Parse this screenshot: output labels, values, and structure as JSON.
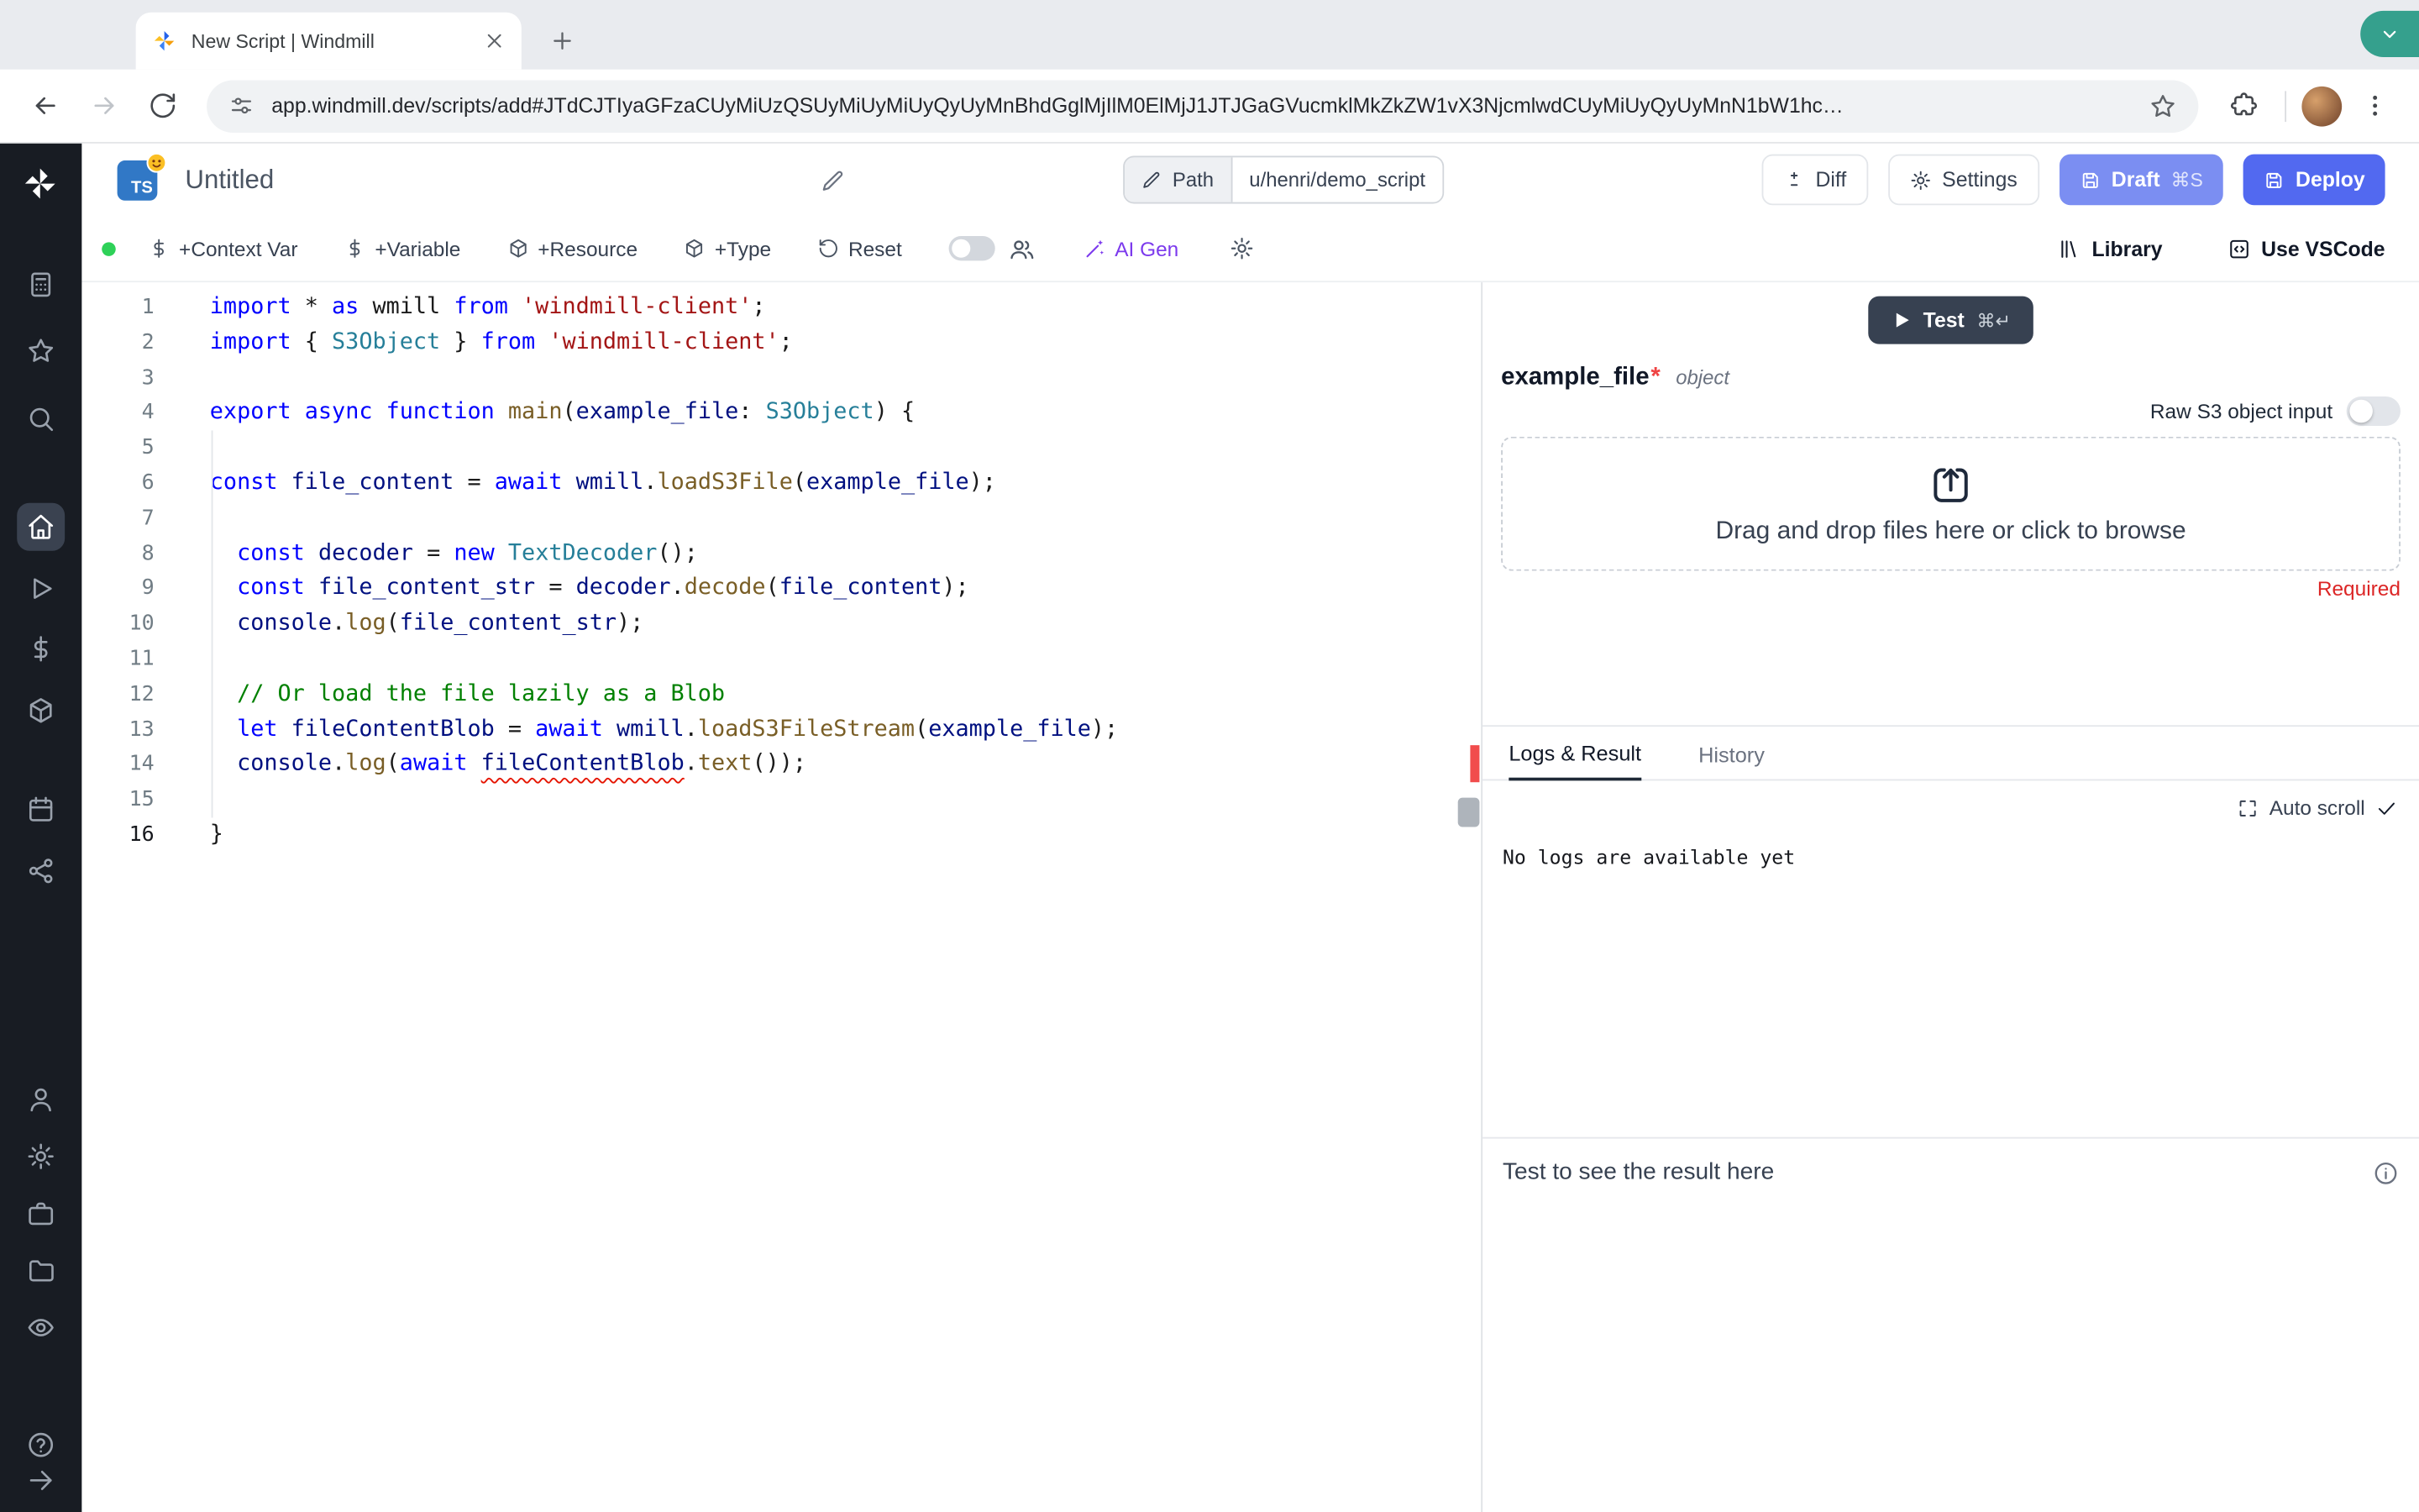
{
  "browser": {
    "tab_title": "New Script | Windmill",
    "url": "app.windmill.dev/scripts/add#JTdCJTIyaGFzaCUyMiUzQSUyMiUyMiUyQyUyMnBhdGglMjIlM0ElMjJ1JTJGaGVucmklMkZkZW1vX3NjcmlwdCUyMiUyQyUyMnN1bW1hc…"
  },
  "header": {
    "lang_badge": "TS",
    "title": "Untitled",
    "path_label": "Path",
    "path_value": "u/henri/demo_script",
    "diff": "Diff",
    "settings": "Settings",
    "draft": "Draft",
    "draft_shortcut": "⌘S",
    "deploy": "Deploy"
  },
  "toolbar": {
    "items": [
      {
        "icon": "dollar",
        "label": "+Context Var",
        "name": "add-context-var"
      },
      {
        "icon": "dollar",
        "label": "+Variable",
        "name": "add-variable"
      },
      {
        "icon": "box",
        "label": "+Resource",
        "name": "add-resource"
      },
      {
        "icon": "box",
        "label": "+Type",
        "name": "add-type"
      },
      {
        "icon": "rotateccw",
        "label": "Reset",
        "name": "reset"
      }
    ],
    "ai_gen": "AI Gen",
    "library": "Library",
    "vscode": "Use VSCode"
  },
  "sidebar": {
    "items": [
      {
        "icon": "calculator",
        "name": "apps"
      },
      {
        "icon": "star",
        "name": "favorites"
      },
      {
        "icon": "search",
        "name": "search"
      },
      {
        "icon": "home",
        "name": "home",
        "active": true
      },
      {
        "icon": "play",
        "name": "runs"
      },
      {
        "icon": "dollar",
        "name": "variables"
      },
      {
        "icon": "box",
        "name": "resources"
      },
      {
        "icon": "calendar",
        "name": "schedules"
      },
      {
        "icon": "nodes",
        "name": "flows"
      },
      {
        "icon": "user",
        "name": "users"
      },
      {
        "icon": "gear",
        "name": "settings"
      },
      {
        "icon": "briefcase",
        "name": "workers"
      },
      {
        "icon": "folder",
        "name": "folders"
      },
      {
        "icon": "eye",
        "name": "audit-logs"
      },
      {
        "icon": "help",
        "name": "help"
      },
      {
        "icon": "arrowright",
        "name": "expand-sidebar"
      }
    ]
  },
  "editor": {
    "active_line": 16,
    "lines": [
      [
        [
          "k",
          "import"
        ],
        [
          "p",
          " * "
        ],
        [
          "k",
          "as"
        ],
        [
          "p",
          " wmill "
        ],
        [
          "k",
          "from"
        ],
        [
          "p",
          " "
        ],
        [
          "s",
          "'windmill-client'"
        ],
        [
          "p",
          ";"
        ]
      ],
      [
        [
          "k",
          "import"
        ],
        [
          "p",
          " { "
        ],
        [
          "t",
          "S3Object"
        ],
        [
          "p",
          " } "
        ],
        [
          "k",
          "from"
        ],
        [
          "p",
          " "
        ],
        [
          "s",
          "'windmill-client'"
        ],
        [
          "p",
          ";"
        ]
      ],
      [],
      [
        [
          "k",
          "export"
        ],
        [
          "p",
          " "
        ],
        [
          "k",
          "async"
        ],
        [
          "p",
          " "
        ],
        [
          "k",
          "function"
        ],
        [
          "p",
          " "
        ],
        [
          "f",
          "main"
        ],
        [
          "p",
          "("
        ],
        [
          "v",
          "example_file"
        ],
        [
          "p",
          ": "
        ],
        [
          "t",
          "S3Object"
        ],
        [
          "p",
          ") {"
        ]
      ],
      [],
      [
        [
          "k",
          "const"
        ],
        [
          "p",
          " "
        ],
        [
          "v",
          "file_content"
        ],
        [
          "p",
          " = "
        ],
        [
          "k",
          "await"
        ],
        [
          "p",
          " "
        ],
        [
          "v",
          "wmill"
        ],
        [
          "p",
          "."
        ],
        [
          "f",
          "loadS3File"
        ],
        [
          "p",
          "("
        ],
        [
          "v",
          "example_file"
        ],
        [
          "p",
          ");"
        ]
      ],
      [],
      [
        [
          "p",
          "  "
        ],
        [
          "k",
          "const"
        ],
        [
          "p",
          " "
        ],
        [
          "v",
          "decoder"
        ],
        [
          "p",
          " = "
        ],
        [
          "k",
          "new"
        ],
        [
          "p",
          " "
        ],
        [
          "t",
          "TextDecoder"
        ],
        [
          "p",
          "();"
        ]
      ],
      [
        [
          "p",
          "  "
        ],
        [
          "k",
          "const"
        ],
        [
          "p",
          " "
        ],
        [
          "v",
          "file_content_str"
        ],
        [
          "p",
          " = "
        ],
        [
          "v",
          "decoder"
        ],
        [
          "p",
          "."
        ],
        [
          "f",
          "decode"
        ],
        [
          "p",
          "("
        ],
        [
          "v",
          "file_content"
        ],
        [
          "p",
          ");"
        ]
      ],
      [
        [
          "p",
          "  "
        ],
        [
          "v",
          "console"
        ],
        [
          "p",
          "."
        ],
        [
          "f",
          "log"
        ],
        [
          "p",
          "("
        ],
        [
          "v",
          "file_content_str"
        ],
        [
          "p",
          ");"
        ]
      ],
      [],
      [
        [
          "p",
          "  "
        ],
        [
          "c",
          "// Or load the file lazily as a Blob"
        ]
      ],
      [
        [
          "p",
          "  "
        ],
        [
          "k",
          "let"
        ],
        [
          "p",
          " "
        ],
        [
          "v",
          "fileContentBlob"
        ],
        [
          "p",
          " = "
        ],
        [
          "k",
          "await"
        ],
        [
          "p",
          " "
        ],
        [
          "v",
          "wmill"
        ],
        [
          "p",
          "."
        ],
        [
          "f",
          "loadS3FileStream"
        ],
        [
          "p",
          "("
        ],
        [
          "v",
          "example_file"
        ],
        [
          "p",
          ");"
        ]
      ],
      [
        [
          "p",
          "  "
        ],
        [
          "v",
          "console"
        ],
        [
          "p",
          "."
        ],
        [
          "f",
          "log"
        ],
        [
          "p",
          "("
        ],
        [
          "k",
          "await"
        ],
        [
          "p",
          " "
        ],
        [
          "v sq",
          "fileContentBlob"
        ],
        [
          "p",
          "."
        ],
        [
          "f",
          "text"
        ],
        [
          "p",
          "());"
        ]
      ],
      [],
      [
        [
          "p",
          "}"
        ]
      ]
    ]
  },
  "panel": {
    "test": "Test",
    "test_shortcut": "⌘↵",
    "arg_name": "example_file",
    "arg_required_mark": "*",
    "arg_type": "object",
    "raw_s3": "Raw S3 object input",
    "dropzone": "Drag and drop files here or click to browse",
    "required": "Required",
    "tabs": [
      "Logs & Result",
      "History"
    ],
    "auto_scroll": "Auto scroll",
    "no_logs": "No logs are available yet",
    "result_hint": "Test to see the result here"
  },
  "colors": {
    "ts_badge_blue": "#3178c6",
    "draft_blue": "#7b8ef2",
    "deploy_blue": "#5269f0",
    "ai_violet": "#7c3aed",
    "error_red": "#dc2626",
    "success_green": "#2ed158",
    "test_button": "#374151",
    "sidebar_bg": "#181c23",
    "share_teal": "#35a08d"
  }
}
